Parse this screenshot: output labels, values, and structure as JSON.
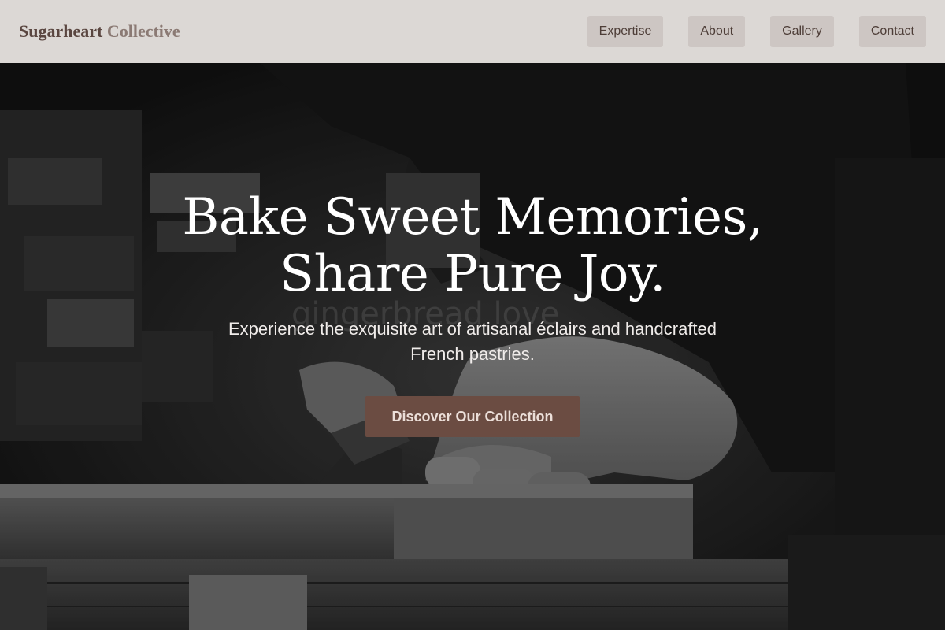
{
  "brand": {
    "primary": "Sugarheart",
    "secondary": "Collective"
  },
  "nav": {
    "items": [
      {
        "label": "Expertise"
      },
      {
        "label": "About"
      },
      {
        "label": "Gallery"
      },
      {
        "label": "Contact"
      }
    ]
  },
  "hero": {
    "headline_line1": "Bake Sweet Memories,",
    "headline_line2": "Share Pure Joy.",
    "subtext": "Experience the exquisite art of artisanal éclairs and handcrafted French pastries.",
    "cta_label": "Discover Our Collection",
    "photo_overlay_text": "gingerbread love"
  },
  "colors": {
    "nav_background": "#dcd8d5",
    "nav_button": "#cdc6c3",
    "brand_primary": "#5a4640",
    "brand_secondary": "#8b7a74",
    "cta_background": "#6b4c42",
    "headline": "#ffffff"
  }
}
